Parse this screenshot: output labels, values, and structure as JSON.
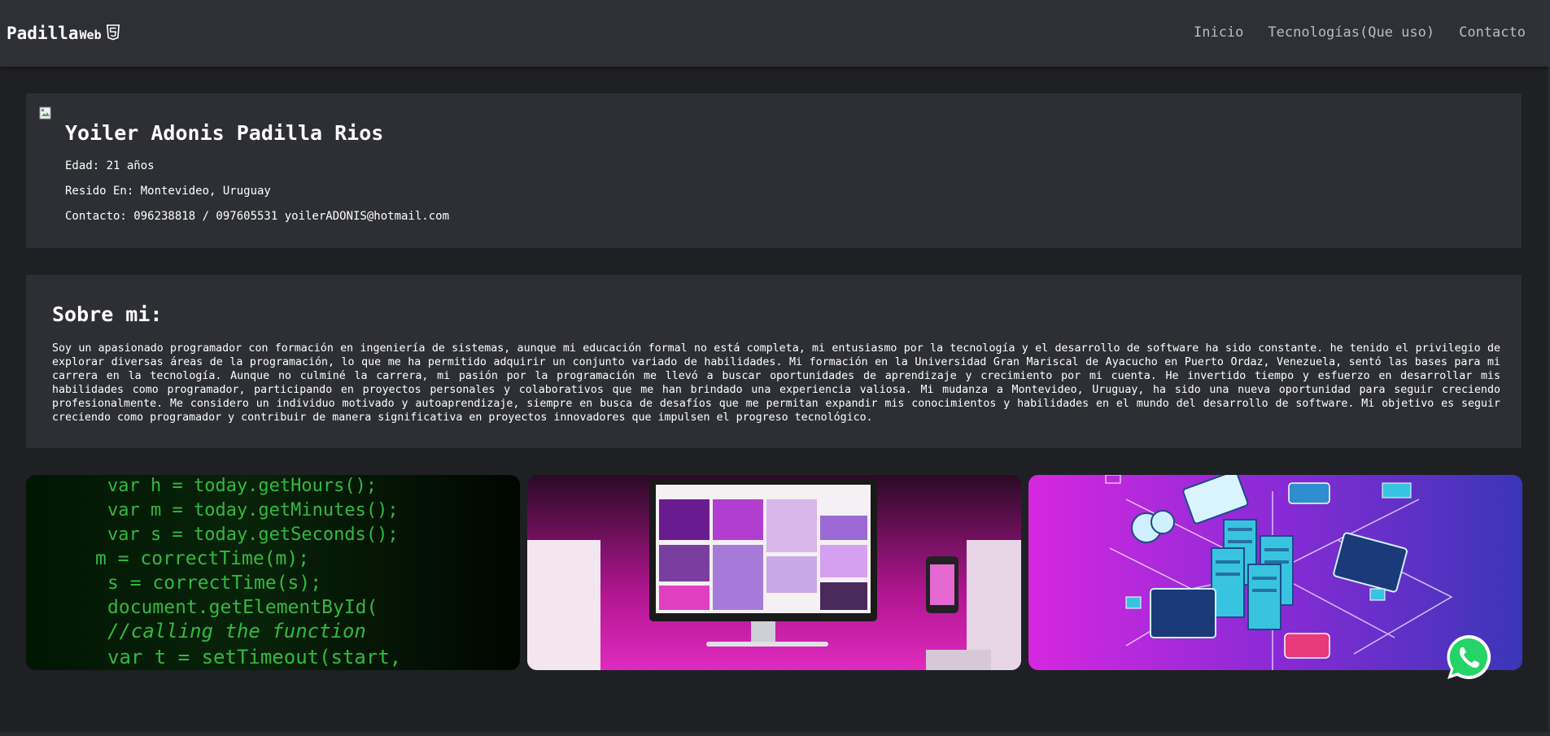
{
  "navbar": {
    "brand_main": "Padilla",
    "brand_sub": "Web",
    "brand_icon": "html5-icon",
    "links": [
      "Inicio",
      "Tecnologías(Que uso)",
      "Contacto"
    ]
  },
  "profile": {
    "name": "Yoiler Adonis Padilla Rios",
    "age": "Edad: 21 años",
    "location": "Resido En: Montevideo, Uruguay",
    "contact": "Contacto: 096238818 / 097605531 yoilerADONIS@hotmail.com"
  },
  "about": {
    "title": "Sobre mi:",
    "text": "Soy un apasionado programador con formación en ingeniería de sistemas, aunque mi educación formal no está completa, mi entusiasmo por la tecnología y el desarrollo de software ha sido constante. he tenido el privilegio de explorar diversas áreas de la programación, lo que me ha permitido adquirir un conjunto variado de habilidades. Mi formación en la Universidad Gran Mariscal de Ayacucho en Puerto Ordaz, Venezuela, sentó las bases para mi carrera en la tecnología. Aunque no culminé la carrera, mi pasión por la programación me llevó a buscar oportunidades de aprendizaje y crecimiento por mi cuenta. He invertido tiempo y esfuerzo en desarrollar mis habilidades como programador, participando en proyectos personales y colaborativos que me han brindado una experiencia valiosa. Mi mudanza a Montevideo, Uruguay, ha sido una nueva oportunidad para seguir creciendo profesionalmente. Me considero un individuo motivado y autoaprendizaje, siempre en busca de desafíos que me permitan expandir mis conocimientos y habilidades en el mundo del desarrollo de software. Mi objetivo es seguir creciendo como programador y contribuir de manera significativa en proyectos innovadores que impulsen el progreso tecnológico."
  },
  "gallery": {
    "code_lines": [
      "var h = today.getHours();",
      "var m = today.getMinutes();",
      "var s = today.getSeconds();",
      "m = correctTime(m);",
      "s = correctTime(s);",
      "document.getElementById(",
      "//calling the function",
      "var t = setTimeout(start,"
    ]
  },
  "icons": {
    "whatsapp": "whatsapp-icon",
    "broken_image": "broken-image-icon"
  },
  "colors": {
    "navbar_bg": "#2f3035",
    "page_bg": "#1f2024",
    "card_bg": "#2e2f34",
    "nav_link": "#b9bbc2",
    "whatsapp_green": "#25d366"
  }
}
